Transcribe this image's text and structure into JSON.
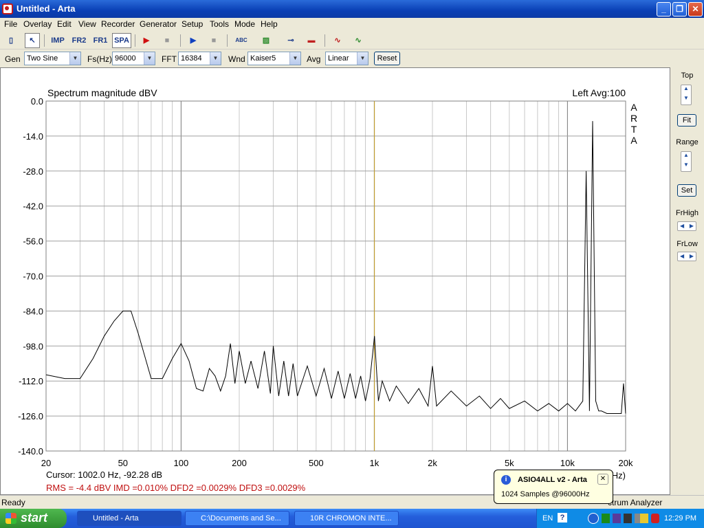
{
  "window": {
    "title": "Untitled - Arta"
  },
  "menu": [
    "File",
    "Overlay",
    "Edit",
    "View",
    "Recorder",
    "Generator",
    "Setup",
    "Tools",
    "Mode",
    "Help"
  ],
  "toolbar": {
    "imp": "IMP",
    "fr2": "FR2",
    "fr1": "FR1",
    "spa": "SPA"
  },
  "settings": {
    "gen_label": "Gen",
    "gen_value": "Two Sine",
    "fs_label": "Fs(Hz)",
    "fs_value": "96000",
    "fft_label": "FFT",
    "fft_value": "16384",
    "wnd_label": "Wnd",
    "wnd_value": "Kaiser5",
    "avg_label": "Avg",
    "avg_value": "Linear",
    "reset_label": "Reset"
  },
  "right_panel": {
    "top": "Top",
    "fit": "Fit",
    "range": "Range",
    "set": "Set",
    "frhigh": "FrHigh",
    "frlow": "FrLow"
  },
  "readout": {
    "cursor": "Cursor:  1002.0 Hz, -92.28 dB",
    "stats": "RMS =   -4.4 dBV   IMD =0.010%   DFD2 =0.0029%   DFD3 =0.0029%"
  },
  "chart_data": {
    "type": "line",
    "title": "Spectrum magnitude dBV",
    "channel_label": "Left  Avg:100",
    "watermark": "ARTA",
    "xscale": "log",
    "xlim": [
      20,
      20000
    ],
    "ylim": [
      -140,
      0
    ],
    "yticks": [
      0,
      -14,
      -28,
      -42,
      -56,
      -70,
      -84,
      -98,
      -112,
      -126,
      -140
    ],
    "ytick_labels": [
      "0.0",
      "-14.0",
      "-28.0",
      "-42.0",
      "-56.0",
      "-70.0",
      "-84.0",
      "-98.0",
      "-112.0",
      "-126.0",
      "-140.0"
    ],
    "xticks": [
      20,
      50,
      100,
      200,
      500,
      1000,
      2000,
      5000,
      10000,
      20000
    ],
    "xtick_labels": [
      "20",
      "50",
      "100",
      "200",
      "500",
      "1k",
      "2k",
      "5k",
      "10k",
      "20k"
    ],
    "xunit": "Hz)",
    "cursor_x": 1002,
    "grid": true,
    "series": [
      {
        "x": [
          20,
          25,
          30,
          35,
          40,
          45,
          50,
          55,
          60,
          70,
          80,
          90,
          100,
          110,
          120,
          130,
          140,
          150,
          160,
          170,
          180,
          190,
          200,
          215,
          230,
          250,
          270,
          290,
          300,
          320,
          340,
          360,
          380,
          400,
          450,
          500,
          550,
          600,
          650,
          700,
          750,
          800,
          850,
          900,
          950,
          1002,
          1050,
          1100,
          1200,
          1300,
          1500,
          1700,
          1900,
          2000,
          2100,
          2500,
          3000,
          3500,
          4000,
          4500,
          5000,
          6000,
          7000,
          8000,
          9000,
          10000,
          11000,
          12000,
          12500,
          13000,
          13500,
          14000,
          14500,
          15000,
          16000,
          17000,
          18000,
          19000,
          19500,
          20000
        ],
        "y": [
          -109.5,
          -111,
          -111,
          -103,
          -94,
          -88,
          -84,
          -84,
          -93,
          -111,
          -111,
          -103,
          -97,
          -104,
          -115,
          -116,
          -107,
          -110,
          -116,
          -110,
          -97,
          -113,
          -100,
          -113,
          -104,
          -115,
          -100,
          -117,
          -98,
          -118,
          -104,
          -118,
          -105,
          -118,
          -106,
          -118,
          -107,
          -119,
          -108,
          -119,
          -109,
          -119,
          -110,
          -120,
          -111,
          -94,
          -120,
          -112,
          -120,
          -114,
          -121,
          -115,
          -122,
          -106,
          -122,
          -116,
          -122,
          -118,
          -123,
          -119,
          -123,
          -120,
          -124,
          -121,
          -124,
          -121,
          -124,
          -120,
          -28,
          -124,
          -8,
          -120,
          -124,
          -124,
          -125,
          -125,
          -125,
          -125,
          -113,
          -125
        ]
      }
    ]
  }
}
